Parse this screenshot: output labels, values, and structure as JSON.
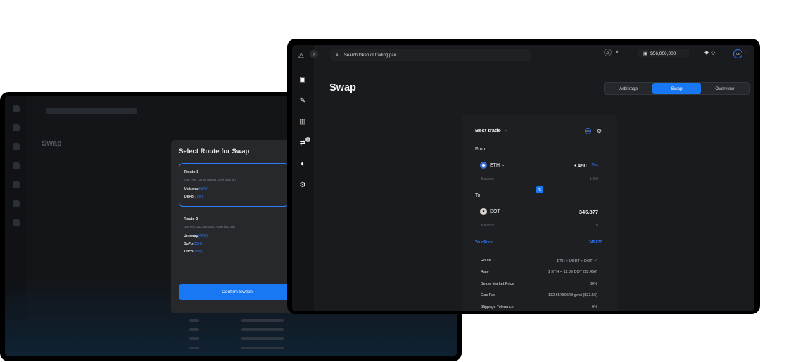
{
  "back_modal": {
    "title": "Select Route for Swap",
    "routes": [
      {
        "name": "Route 1",
        "meta": "Gas Fee: 132.65789543 Gwei ($33.56)",
        "exchanges": [
          {
            "name": "Uniswap",
            "pct": "(63%)"
          },
          {
            "name": "DePo",
            "pct": "(37%)"
          }
        ]
      },
      {
        "name": "Route 2",
        "meta": "Gas Fee: 132.65789543 Gwei ($33.56)",
        "exchanges": [
          {
            "name": "Uniswap",
            "pct": "(40%)"
          },
          {
            "name": "DuPo",
            "pct": "(35%)"
          },
          {
            "name": "1inch",
            "pct": "(25%)"
          }
        ]
      }
    ],
    "confirm_label": "Confirm Switch"
  },
  "back_page": {
    "title": "Swap"
  },
  "topbar": {
    "search_placeholder": "Search token or trading pair",
    "gas_value": "0",
    "wallet_balance": "$56,000,000",
    "account_label": "0x"
  },
  "page_title": "Swap",
  "tabs": [
    {
      "label": "Arbitrage",
      "active": false
    },
    {
      "label": "Swap",
      "active": true
    },
    {
      "label": "Overview",
      "active": false
    }
  ],
  "sidebar_badge": "2",
  "swap": {
    "best_trade_label": "Best trade",
    "settings_badge": "RO",
    "from_label": "From",
    "from_token": "ETH",
    "from_amount": "3.450",
    "max_label": "Max",
    "from_balance_label": "Balance",
    "from_balance": "3.450",
    "to_label": "To",
    "to_token": "DOT",
    "to_amount": "345.877",
    "to_balance_label": "Balance",
    "to_balance": "0",
    "your_price_label": "Your Price",
    "your_price_value": "345.877",
    "details": [
      {
        "label": "Route",
        "value": "ETH > USDT > DOT"
      },
      {
        "label": "Rate",
        "value": "1 ETH = 11.09 DOT ($5,456)"
      },
      {
        "label": "Below Market Price",
        "value": "30%"
      },
      {
        "label": "Gas Fee",
        "value": "132.65789543 gwei ($32.56)"
      },
      {
        "label": "Slippage Tolerance",
        "value": "6%"
      }
    ]
  },
  "colors": {
    "accent": "#1877f2",
    "background": "#1a1b1e"
  }
}
